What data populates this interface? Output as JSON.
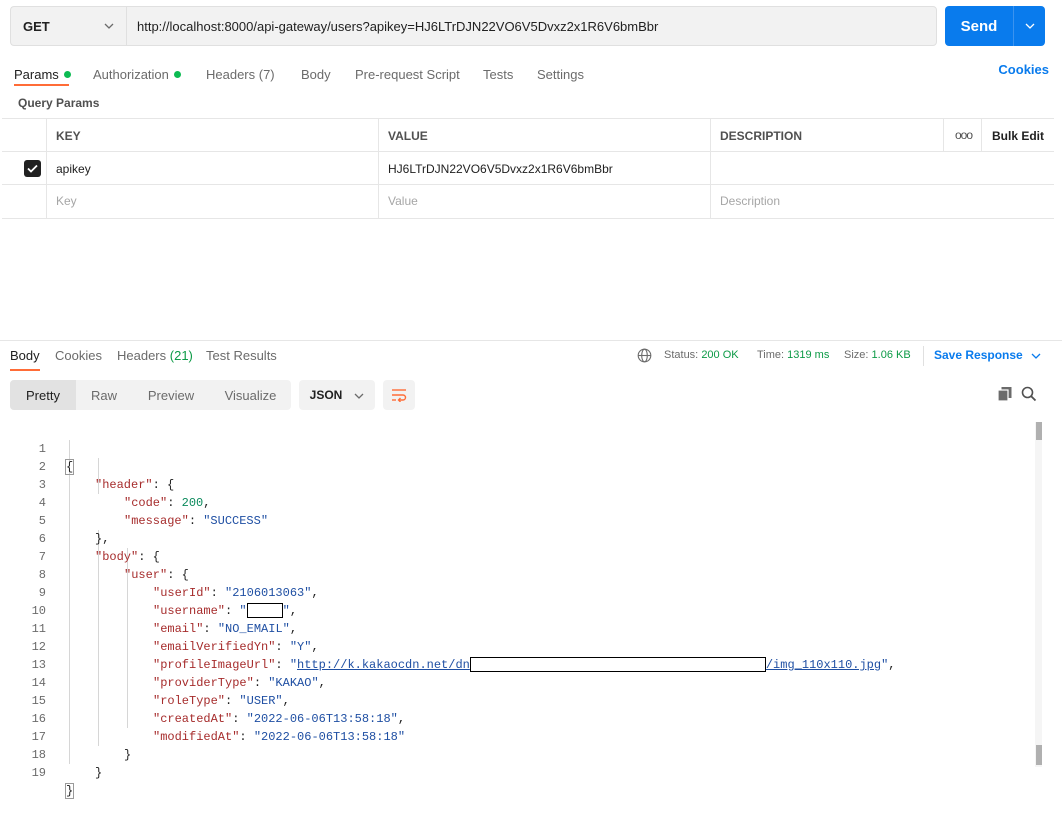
{
  "request": {
    "method": "GET",
    "url": "http://localhost:8000/api-gateway/users?apikey=HJ6LTrDJN22VO6V5Dvxz2x1R6V6bmBbr",
    "send_label": "Send"
  },
  "request_tabs": {
    "params": "Params",
    "authorization": "Authorization",
    "headers": "Headers (7)",
    "body": "Body",
    "pre_request": "Pre-request Script",
    "tests": "Tests",
    "settings": "Settings",
    "cookies": "Cookies"
  },
  "query_params": {
    "title": "Query Params",
    "columns": {
      "key": "KEY",
      "value": "VALUE",
      "description": "DESCRIPTION",
      "more": "ooo",
      "bulk_edit": "Bulk Edit"
    },
    "rows": [
      {
        "checked": true,
        "key": "apikey",
        "value": "HJ6LTrDJN22VO6V5Dvxz2x1R6V6bmBbr",
        "description": ""
      }
    ],
    "placeholders": {
      "key": "Key",
      "value": "Value",
      "description": "Description"
    }
  },
  "response_tabs": {
    "body": "Body",
    "cookies": "Cookies",
    "headers_label": "Headers",
    "headers_count": "(21)",
    "test_results": "Test Results"
  },
  "response_meta": {
    "status_label": "Status:",
    "status_value": "200 OK",
    "time_label": "Time:",
    "time_value": "1319 ms",
    "size_label": "Size:",
    "size_value": "1.06 KB",
    "save_response": "Save Response"
  },
  "format": {
    "pretty": "Pretty",
    "raw": "Raw",
    "preview": "Preview",
    "visualize": "Visualize",
    "language": "JSON"
  },
  "body_lines": {
    "l2_key": "\"header\"",
    "l3_key": "\"code\"",
    "l3_val": "200",
    "l4_key": "\"message\"",
    "l4_val": "\"SUCCESS\"",
    "l6_key": "\"body\"",
    "l7_key": "\"user\"",
    "l8_key": "\"userId\"",
    "l8_val": "\"2106013063\"",
    "l9_key": "\"username\"",
    "l10_key": "\"email\"",
    "l10_val": "\"NO_EMAIL\"",
    "l11_key": "\"emailVerifiedYn\"",
    "l11_val": "\"Y\"",
    "l12_key": "\"profileImageUrl\"",
    "l12_link_start": "http://k.kakaocdn.net/dn",
    "l12_link_end": "/img_110x110.jpg",
    "l13_key": "\"providerType\"",
    "l13_val": "\"KAKAO\"",
    "l14_key": "\"roleType\"",
    "l14_val": "\"USER\"",
    "l15_key": "\"createdAt\"",
    "l15_val": "\"2022-06-06T13:58:18\"",
    "l16_key": "\"modifiedAt\"",
    "l16_val": "\"2022-06-06T13:58:18\""
  },
  "colors": {
    "accent": "#097bed",
    "tab_indicator": "#ff6c37",
    "status_green": "#0c9a46",
    "json_key": "#a62c2c",
    "json_string": "#1f4fa3",
    "json_number": "#0b8a5c"
  }
}
